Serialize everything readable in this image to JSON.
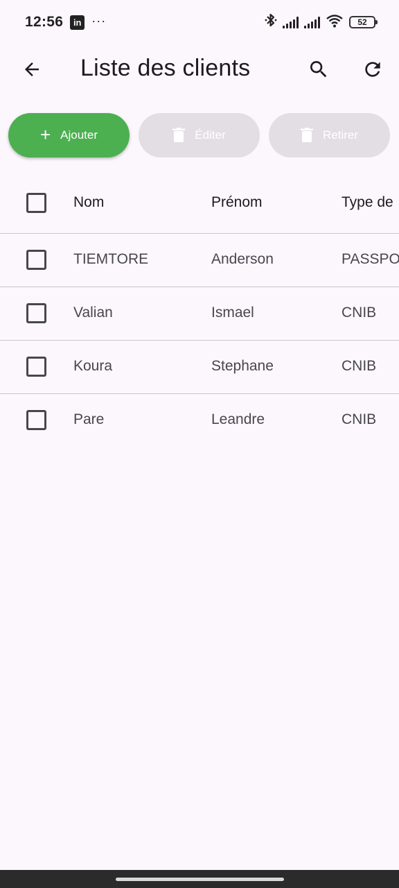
{
  "status_bar": {
    "time": "12:56",
    "app_badge": "in",
    "more": "···",
    "battery": "52"
  },
  "app_bar": {
    "title": "Liste des clients",
    "back_icon": "arrow-back-icon",
    "search_icon": "search-icon",
    "refresh_icon": "refresh-icon"
  },
  "actions": {
    "add_label": "Ajouter",
    "edit_label": "Éditer",
    "remove_label": "Retirer"
  },
  "colors": {
    "accent": "#4caf50",
    "disabled": "#e2dee3",
    "background": "#fcf7fc"
  },
  "table": {
    "columns": [
      "Nom",
      "Prénom",
      "Type de"
    ],
    "rows": [
      {
        "nom": "TIEMTORE",
        "prenom": "Anderson",
        "type": "PASSPO"
      },
      {
        "nom": "Valian",
        "prenom": "Ismael",
        "type": "CNIB"
      },
      {
        "nom": "Koura",
        "prenom": "Stephane",
        "type": "CNIB"
      },
      {
        "nom": "Pare",
        "prenom": "Leandre",
        "type": "CNIB"
      }
    ]
  }
}
